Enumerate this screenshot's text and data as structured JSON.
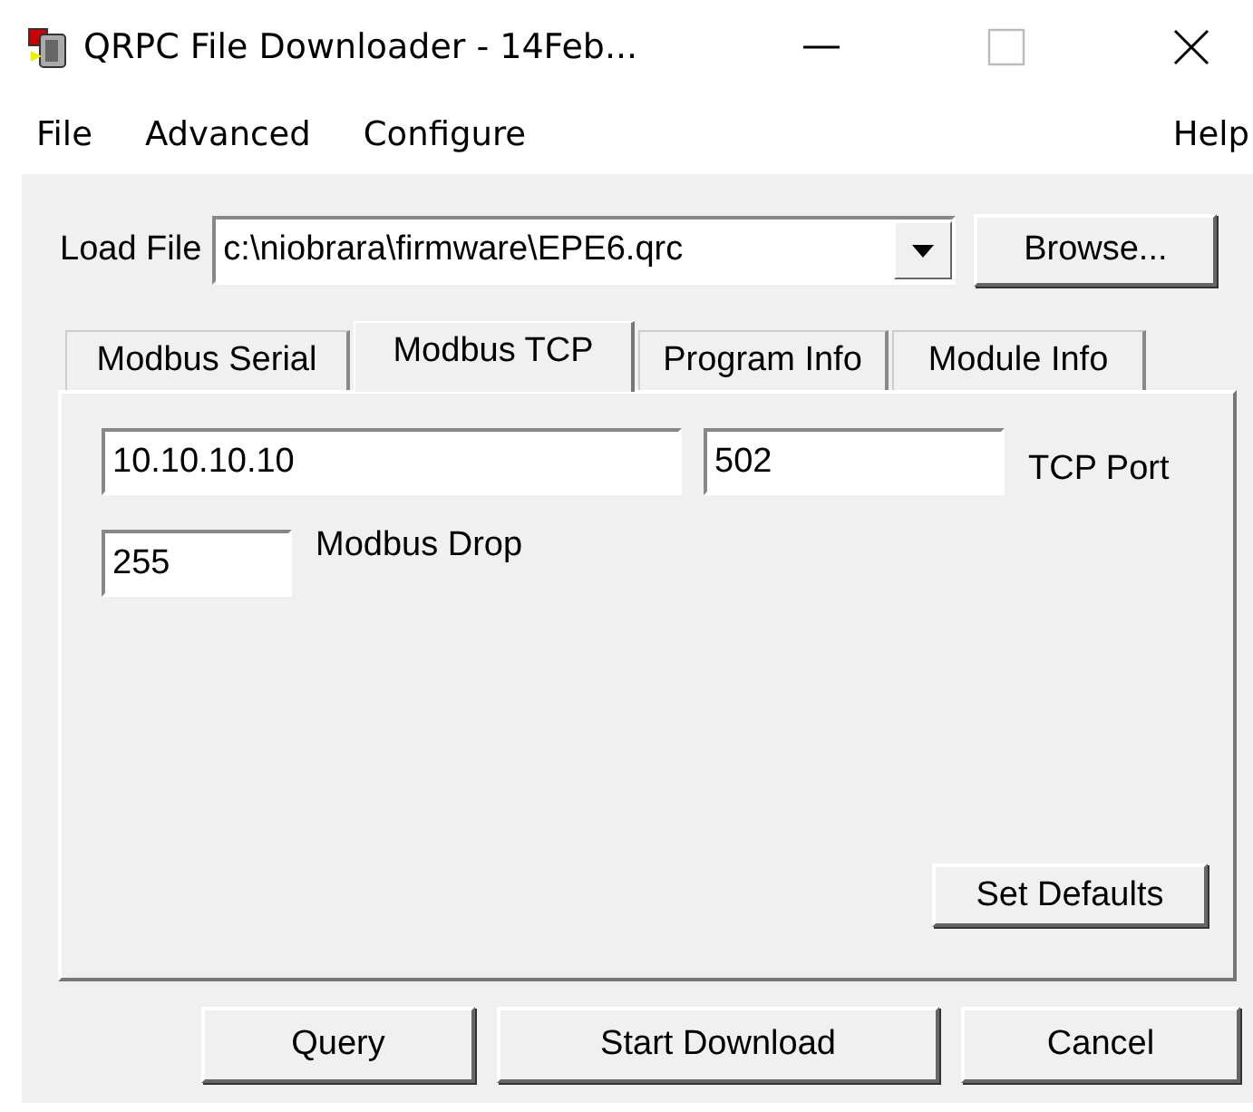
{
  "window": {
    "title": "QRPC File Downloader - 14Feb..."
  },
  "menu": [
    {
      "label": "File"
    },
    {
      "label": "Advanced"
    },
    {
      "label": "Configure"
    },
    {
      "label": "Help"
    }
  ],
  "load_file": {
    "label": "Load File",
    "value": "c:\\niobrara\\firmware\\EPE6.qrc",
    "browse": "Browse..."
  },
  "tabs": [
    {
      "label": "Modbus Serial",
      "selected": false
    },
    {
      "label": "Modbus TCP",
      "selected": true
    },
    {
      "label": "Program Info",
      "selected": false
    },
    {
      "label": "Module Info",
      "selected": false
    }
  ],
  "tcp": {
    "address": "10.10.10.10",
    "port": "502",
    "port_label": "TCP Port",
    "drop": "255",
    "drop_label": "Modbus Drop",
    "set_defaults": "Set Defaults"
  },
  "buttons": [
    "Query",
    "Start Download",
    "Cancel"
  ]
}
